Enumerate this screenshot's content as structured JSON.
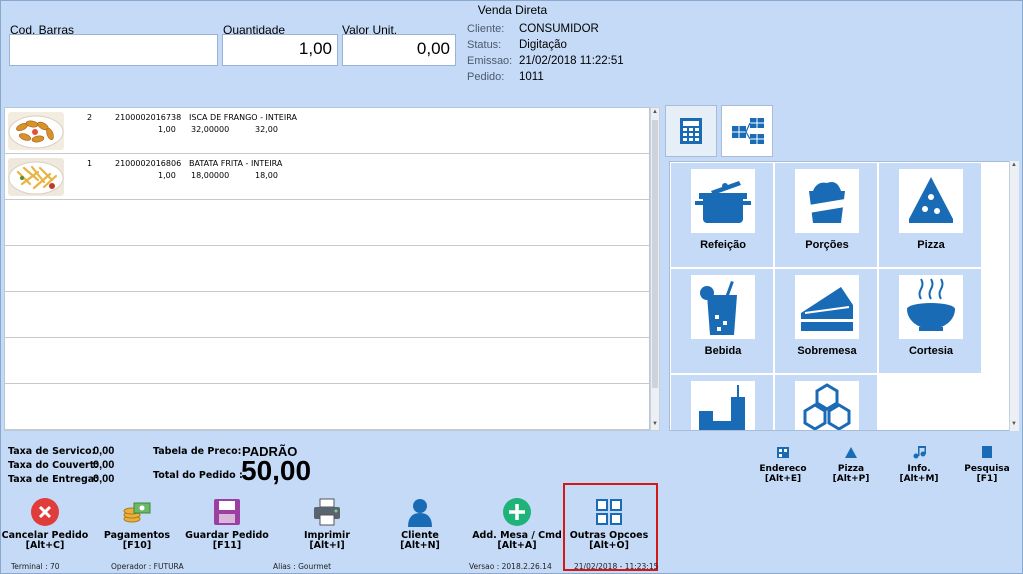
{
  "window": {
    "title": "Venda Direta"
  },
  "entry": {
    "barcode_label": "Cod. Barras",
    "barcode_value": "",
    "quantity_label": "Quantidade",
    "quantity_value": "1,00",
    "unit_price_label": "Valor Unit.",
    "unit_price_value": "0,00"
  },
  "order_info": {
    "cliente_label": "Cliente:",
    "cliente_value": "CONSUMIDOR",
    "status_label": "Status:",
    "status_value": "Digitação",
    "emissao_label": "Emissao:",
    "emissao_value": "21/02/2018 11:22:51",
    "pedido_label": "Pedido:",
    "pedido_value": "1011"
  },
  "items": [
    {
      "seq": "2",
      "code": "2100002016738",
      "description": "ISCA DE FRANGO - INTEIRA",
      "qty": "1,00",
      "unit_price": "32,00000",
      "total": "32,00",
      "thumb": "chicken-strips"
    },
    {
      "seq": "1",
      "code": "2100002016806",
      "description": "BATATA FRITA - INTEIRA",
      "qty": "1,00",
      "unit_price": "18,00000",
      "total": "18,00",
      "thumb": "french-fries"
    }
  ],
  "categories": [
    {
      "label": "Refeição",
      "icon": "pot-icon"
    },
    {
      "label": "Porções",
      "icon": "portion-box-icon"
    },
    {
      "label": "Pizza",
      "icon": "pizza-slice-icon"
    },
    {
      "label": "Bebida",
      "icon": "drink-glass-icon"
    },
    {
      "label": "Sobremesa",
      "icon": "cake-slice-icon"
    },
    {
      "label": "Cortesia",
      "icon": "soup-bowl-icon"
    },
    {
      "label": "",
      "icon": "combo-meal-icon"
    },
    {
      "label": "",
      "icon": "hexagons-icon"
    }
  ],
  "totals": {
    "taxa_servico_label": "Taxa de Servico:",
    "taxa_servico_value": "0,00",
    "taxa_couvert_label": "Taxa do Couvert:",
    "taxa_couvert_value": "0,00",
    "taxa_entrega_label": "Taxa de Entrega:",
    "taxa_entrega_value": "0,00",
    "tabela_label": "Tabela de Preco:",
    "tabela_value": "PADRÃO",
    "total_label": "Total do Pedido :",
    "total_value": "50,00"
  },
  "shortcuts": [
    {
      "label": "Endereco",
      "key": "[Alt+E]",
      "icon": "address-icon"
    },
    {
      "label": "Pizza",
      "key": "[Alt+P]",
      "icon": "triangle-icon"
    },
    {
      "label": "Info.",
      "key": "[Alt+M]",
      "icon": "music-note-icon"
    },
    {
      "label": "Pesquisa",
      "key": "[F1]",
      "icon": "square-icon"
    }
  ],
  "actions": [
    {
      "label": "Cancelar Pedido",
      "key": "[Alt+C]",
      "icon": "cancel-icon"
    },
    {
      "label": "Pagamentos",
      "key": "[F10]",
      "icon": "money-icon"
    },
    {
      "label": "Guardar Pedido",
      "key": "[F11]",
      "icon": "floppy-icon"
    },
    {
      "label": "Imprimir",
      "key": "[Alt+I]",
      "icon": "printer-icon"
    },
    {
      "label": "Cliente",
      "key": "[Alt+N]",
      "icon": "person-icon"
    },
    {
      "label": "Add. Mesa / Cmd",
      "key": "[Alt+A]",
      "icon": "plus-icon"
    },
    {
      "label": "Outras Opcoes",
      "key": "[Alt+O]",
      "icon": "grid-icon"
    }
  ],
  "status_bar": {
    "terminal": "Terminal :  70",
    "operador": "Operador :  FUTURA",
    "alias": "Alias :  Gourmet",
    "versao": "Versao :  2018.2.26.14",
    "datetime": "21/02/2018 - 11:23:15"
  },
  "colors": {
    "background": "#c4daf6",
    "icon_blue": "#1a6bb5",
    "highlight": "#d41818",
    "cancel_red": "#e03c3c",
    "add_green": "#1fb37a"
  }
}
